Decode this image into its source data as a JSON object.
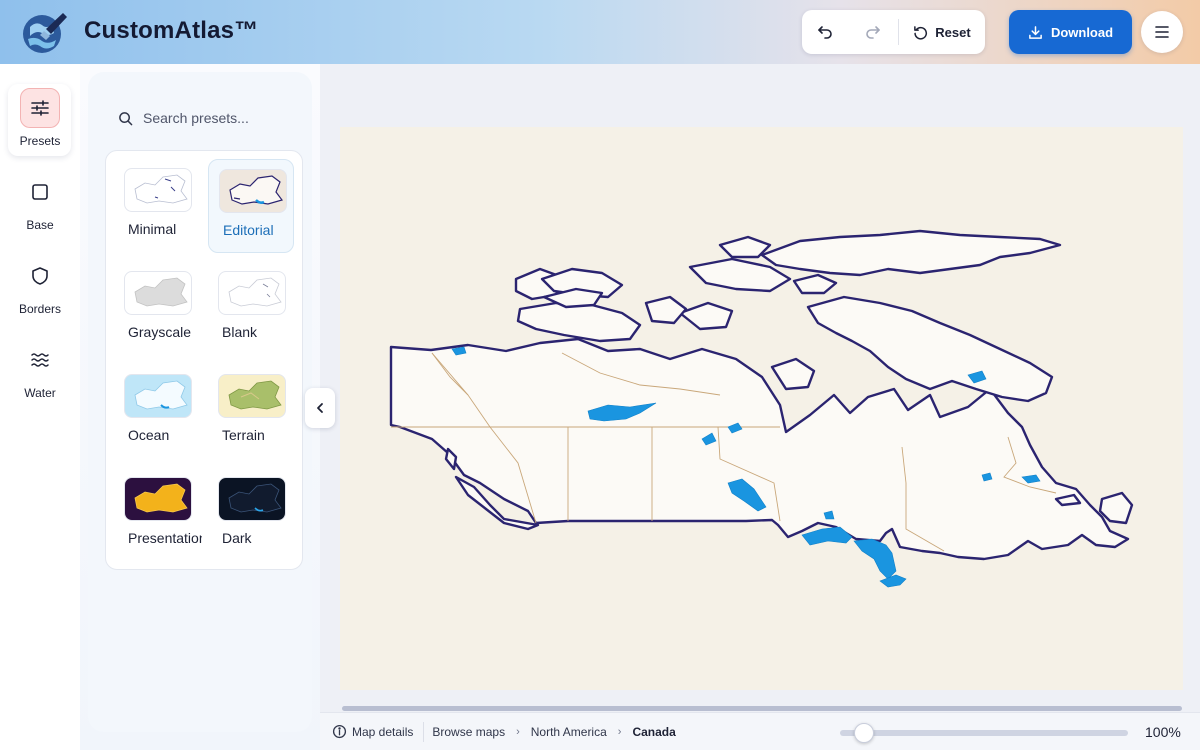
{
  "app": {
    "brand": "CustomAtlas™"
  },
  "toolbar": {
    "reset_label": "Reset",
    "download_label": "Download"
  },
  "rail": [
    {
      "label": "Presets",
      "icon": "sliders-icon",
      "active": true
    },
    {
      "label": "Base",
      "icon": "square-icon"
    },
    {
      "label": "Borders",
      "icon": "shield-icon"
    },
    {
      "label": "Water",
      "icon": "waves-icon"
    }
  ],
  "search": {
    "placeholder": "Search presets..."
  },
  "presets": [
    {
      "label": "Minimal"
    },
    {
      "label": "Editorial",
      "selected": true
    },
    {
      "label": "Grayscale"
    },
    {
      "label": "Blank"
    },
    {
      "label": "Ocean"
    },
    {
      "label": "Terrain"
    },
    {
      "label": "Presentation"
    },
    {
      "label": "Dark"
    }
  ],
  "status": {
    "details_label": "Map details",
    "breadcrumb": [
      "Browse maps",
      "North America",
      "Canada"
    ],
    "zoom_label": "100%"
  },
  "colors": {
    "accent": "#1769d3",
    "border_stroke": "#2b2470",
    "water": "#1a95e0",
    "land": "#fcfaf6",
    "background": "#f5f1e7"
  }
}
